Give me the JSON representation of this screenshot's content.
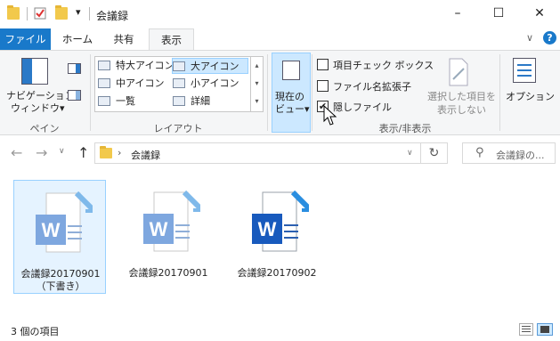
{
  "window": {
    "title": "会議録",
    "minimize": "–",
    "maximize": "☐",
    "close": "✕",
    "dropdown_glyph": "▾"
  },
  "tabs": [
    {
      "label": "ファイル"
    },
    {
      "label": "ホーム"
    },
    {
      "label": "共有"
    },
    {
      "label": "表示"
    }
  ],
  "ribbon": {
    "pane_group": {
      "nav_pane_label_1": "ナビゲーション",
      "nav_pane_label_2": "ウィンドウ▾",
      "group_label": "ペイン"
    },
    "layout_group": {
      "items": [
        {
          "label": "特大アイコン"
        },
        {
          "label": "大アイコン"
        },
        {
          "label": "中アイコン"
        },
        {
          "label": "小アイコン"
        },
        {
          "label": "一覧"
        },
        {
          "label": "詳細"
        }
      ],
      "group_label": "レイアウト"
    },
    "current_view": {
      "label_1": "現在の",
      "label_2": "ビュー▾"
    },
    "show_hide": {
      "item_checkboxes": "項目チェック ボックス",
      "file_extensions": "ファイル名拡張子",
      "hidden_items": "隠しファイル",
      "hide_selected_1": "選択した項目を",
      "hide_selected_2": "表示しない",
      "group_label": "表示/非表示"
    },
    "options": {
      "label": "オプション"
    }
  },
  "address": {
    "path": "会議録",
    "search_placeholder": "会議録の..."
  },
  "files": [
    {
      "name_1": "会議録20170901",
      "name_2": "（下書き）",
      "letter": "W"
    },
    {
      "name_1": "会議録20170901",
      "name_2": "",
      "letter": "W"
    },
    {
      "name_1": "会議録20170902",
      "name_2": "",
      "letter": "W"
    }
  ],
  "status": {
    "item_count": "3 個の項目"
  },
  "colors": {
    "accent": "#1979ca",
    "word_dark": "#185abd",
    "word_light": "#7ea7df"
  }
}
